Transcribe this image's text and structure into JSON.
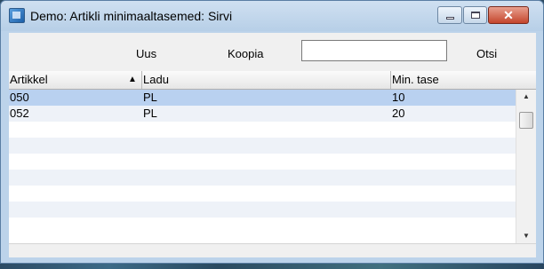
{
  "window": {
    "title": "Demo: Artikli minimaaltasemed: Sirvi"
  },
  "toolbar": {
    "new_label": "Uus",
    "copy_label": "Koopia",
    "search_value": "",
    "search_label": "Otsi"
  },
  "table": {
    "columns": [
      "Artikkel",
      "Ladu",
      "Min. tase"
    ],
    "sort_column": "Artikkel",
    "sort_direction": "ascending",
    "rows": [
      {
        "artikkel": "050",
        "ladu": "PL",
        "min_tase": "10",
        "selected": true
      },
      {
        "artikkel": "052",
        "ladu": "PL",
        "min_tase": "20",
        "selected": false
      }
    ]
  },
  "icons": {
    "app": "app-window-icon",
    "minimize": "minimize-icon",
    "maximize": "maximize-icon",
    "close": "close-icon",
    "sort": "sort-ascending-icon",
    "scroll_up": "scroll-up-arrow-icon",
    "scroll_down": "scroll-down-arrow-icon"
  },
  "colors": {
    "selected_row": "#b9d1f0",
    "close_button": "#c4452c"
  }
}
